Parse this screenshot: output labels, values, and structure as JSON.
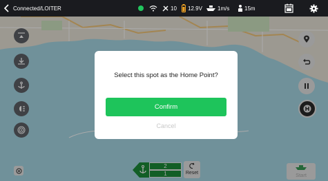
{
  "status_bar": {
    "connection_status": "Connected/LOITER",
    "satellites": "10",
    "voltage": "12.9V",
    "speed": "1m/s",
    "distance": "15m",
    "back_icon": "chevron-left-icon",
    "gps_indicator_color": "#22c55e"
  },
  "left_toolbar": {
    "icons": [
      "lift-icon",
      "drop-anchor-icon",
      "anchor-icon",
      "lights-icon",
      "radar-icon"
    ]
  },
  "right_toolbar": {
    "icons": [
      "location-pin-icon",
      "return-icon",
      "pause-icon",
      "home-h-icon"
    ]
  },
  "dialog": {
    "title": "Select this spot as the Home Point?",
    "confirm_label": "Confirm",
    "cancel_label": "Cancel",
    "confirm_color": "#1ec45b"
  },
  "bottom_bar": {
    "gear_top": "2",
    "gear_bottom": "1",
    "reset_label": "Reset",
    "start_label": "Start"
  }
}
